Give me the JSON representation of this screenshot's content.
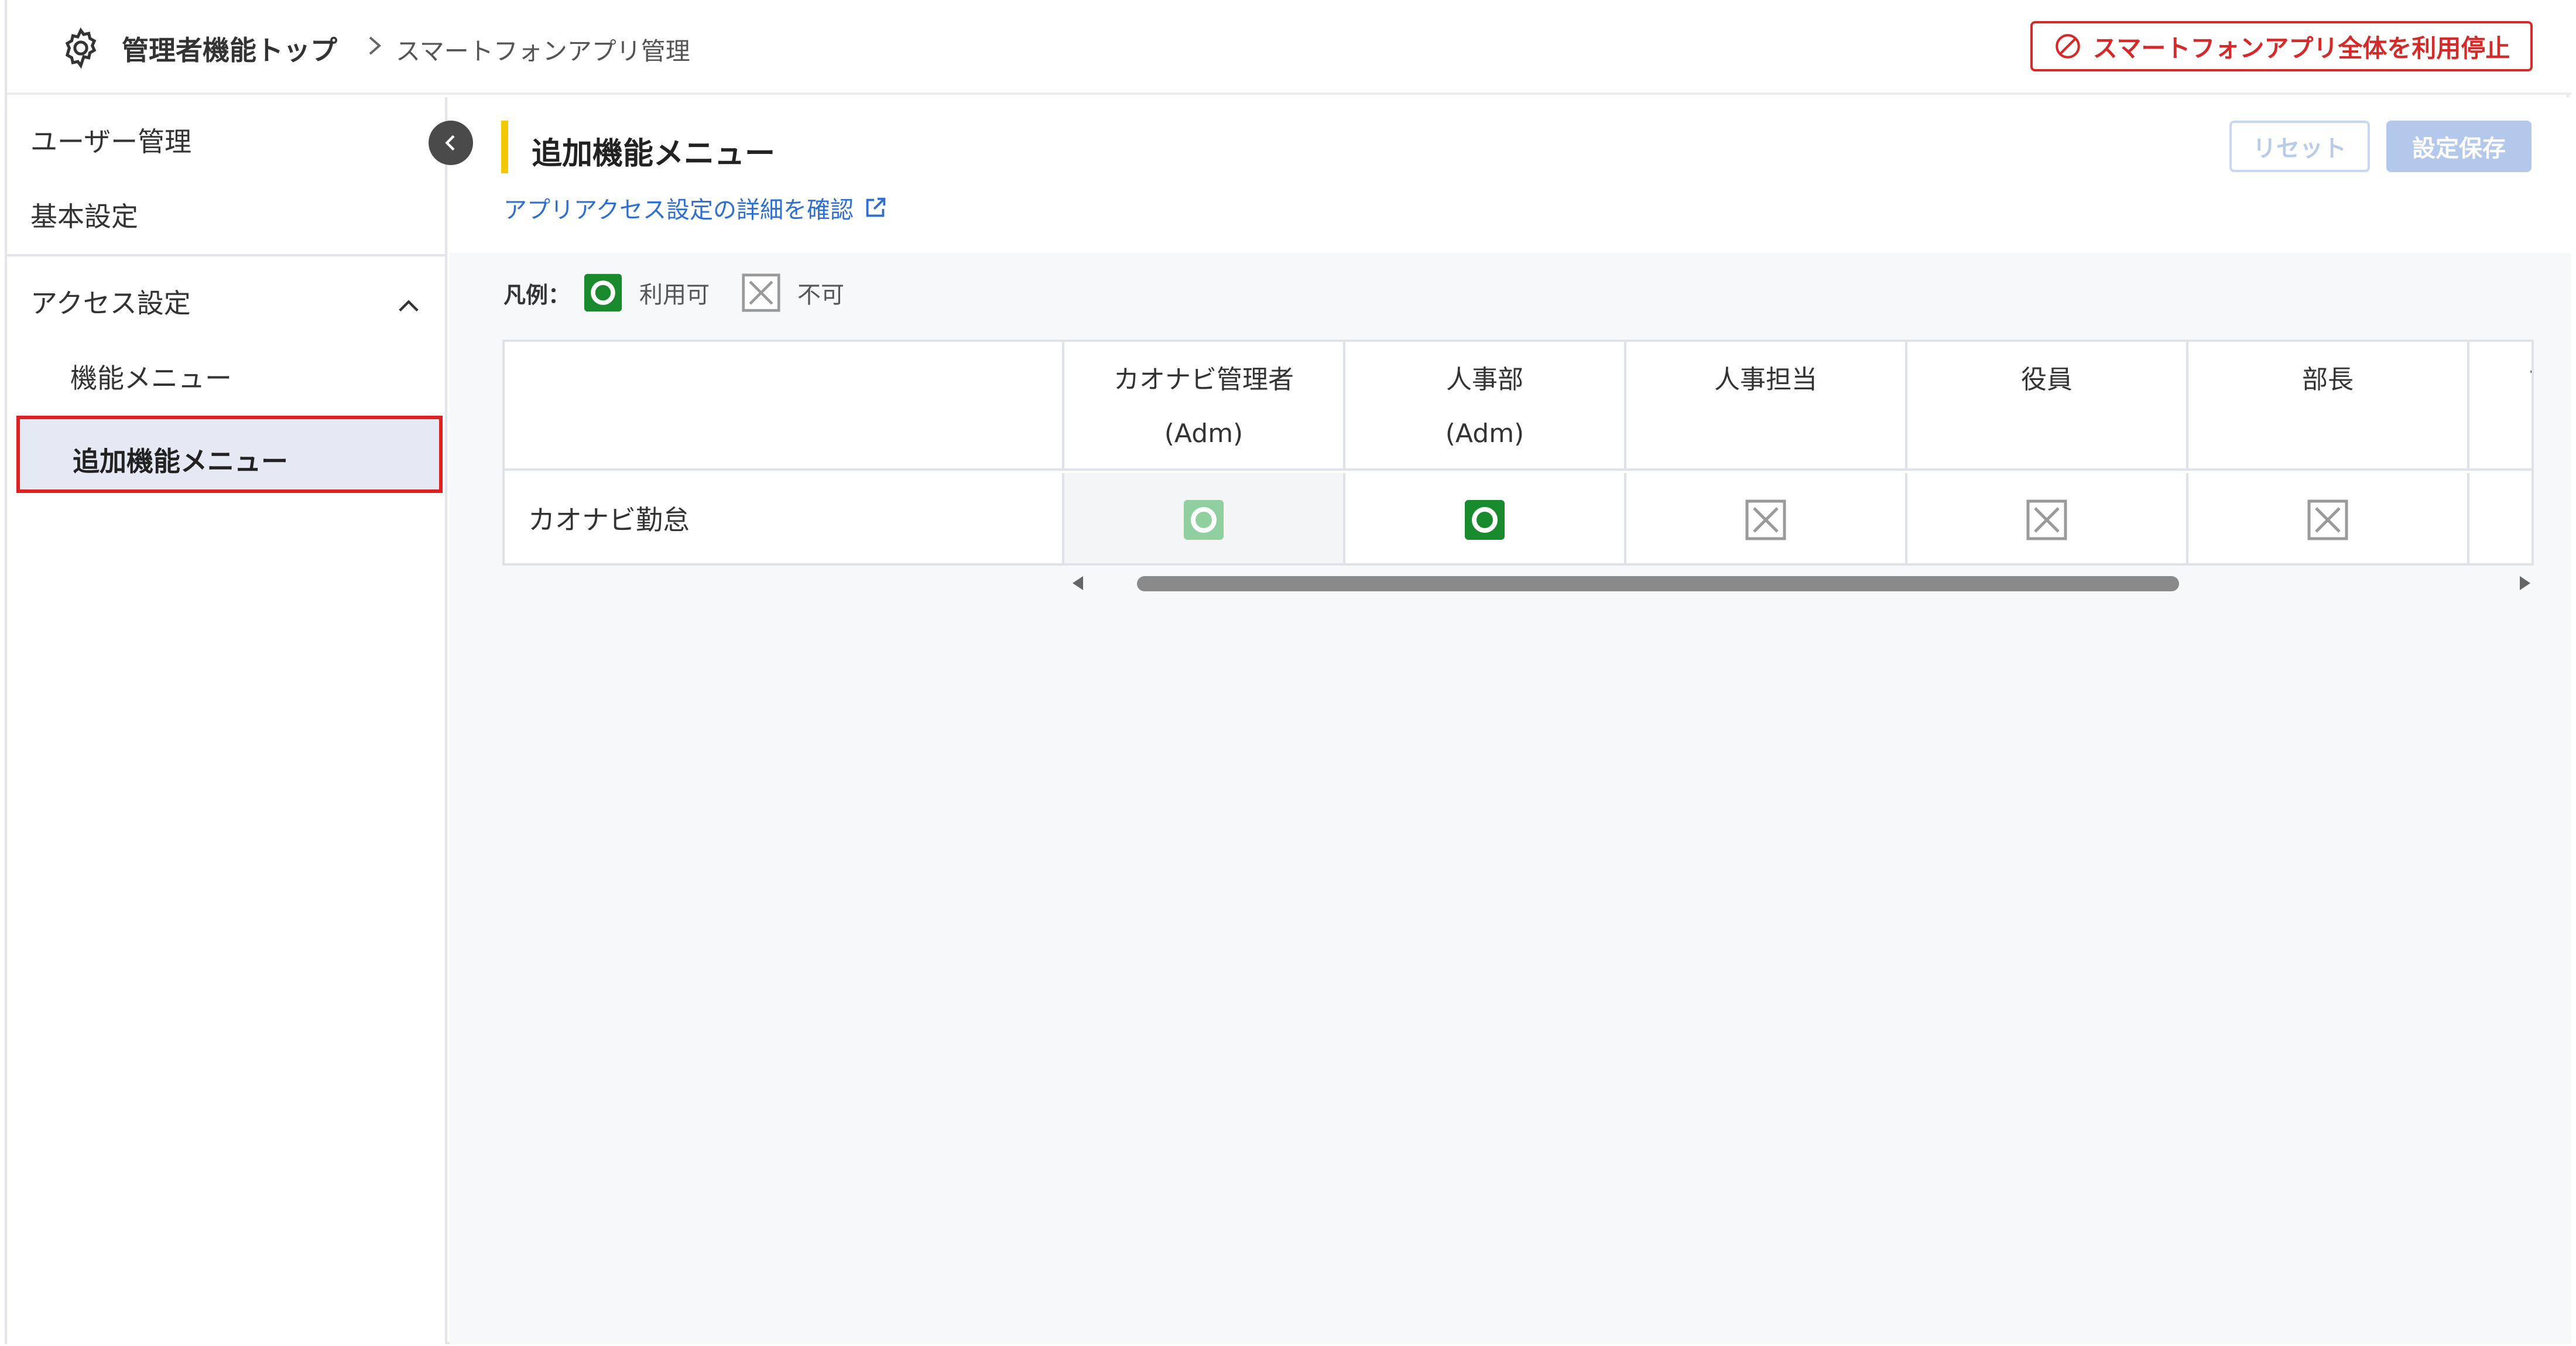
{
  "header": {
    "breadcrumb_top": "管理者機能トップ",
    "breadcrumb_current": "スマートフォンアプリ管理",
    "stop_button_label": "スマートフォンアプリ全体を利用停止"
  },
  "sidebar": {
    "items": [
      {
        "label": "ユーザー管理"
      },
      {
        "label": "基本設定"
      },
      {
        "label": "アクセス設定",
        "expanded": true
      }
    ],
    "sub_items": [
      {
        "label": "機能メニュー"
      },
      {
        "label": "追加機能メニュー",
        "active": true
      }
    ]
  },
  "main": {
    "title": "追加機能メニュー",
    "detail_link": "アプリアクセス設定の詳細を確認",
    "reset_label": "リセット",
    "save_label": "設定保存",
    "legend": {
      "label": "凡例：",
      "allowed": "利用可",
      "denied": "不可"
    },
    "table": {
      "columns": [
        {
          "line1": "カオナビ管理者",
          "line2": "(Adm)"
        },
        {
          "line1": "人事部",
          "line2": "(Adm)"
        },
        {
          "line1": "人事担当",
          "line2": ""
        },
        {
          "line1": "役員",
          "line2": ""
        },
        {
          "line1": "部長",
          "line2": ""
        },
        {
          "line1": "マ",
          "line2": ""
        }
      ],
      "rows": [
        {
          "label": "カオナビ勤怠",
          "values": [
            "allowed-locked",
            "allowed",
            "denied",
            "denied",
            "denied",
            "hidden"
          ]
        }
      ]
    }
  },
  "colors": {
    "accent_yellow": "#f2c900",
    "allowed_green": "#1a8a2e",
    "allowed_locked_green": "#8fcfa0",
    "danger_red": "#d42a2a",
    "link_blue": "#2f6fd1"
  }
}
